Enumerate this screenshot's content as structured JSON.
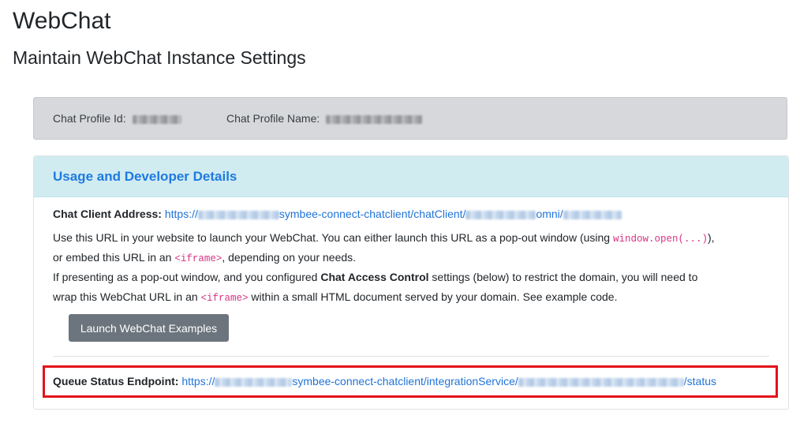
{
  "header": {
    "title": "WebChat",
    "subtitle": "Maintain WebChat Instance Settings"
  },
  "profile": {
    "id_label": "Chat Profile Id:",
    "name_label": "Chat Profile Name:"
  },
  "usage_card": {
    "title": "Usage and Developer Details",
    "client_address_label": "Chat Client Address:",
    "client_address_prefix": "https://",
    "client_address_mid": "symbee-connect-chatclient/chatClient/",
    "client_address_omni": "omni/",
    "desc1_a": "Use this URL in your website to launch your WebChat. You can either launch this URL as a pop-out window (using ",
    "desc1_code": "window.open(...)",
    "desc1_b": "),",
    "desc2_a": "or embed this URL in an ",
    "desc2_code": "<iframe>",
    "desc2_b": ", depending on your needs.",
    "desc3_a": "If presenting as a pop-out window, and you configured ",
    "desc3_bold": "Chat Access Control",
    "desc3_b": " settings (below) to restrict the domain, you will need to",
    "desc4_a": "wrap this WebChat URL in an ",
    "desc4_code": "<iframe>",
    "desc4_b": " within a small HTML document served by your domain. See example code.",
    "launch_button": "Launch WebChat Examples",
    "queue_label": "Queue Status Endpoint:",
    "queue_prefix": "https://",
    "queue_mid": "symbee-connect-chatclient/integrationService/",
    "queue_suffix": "/status"
  },
  "colors": {
    "accent": "#1f7ae0",
    "highlight": "#e3121b",
    "header_bg": "#d1ecf1"
  }
}
